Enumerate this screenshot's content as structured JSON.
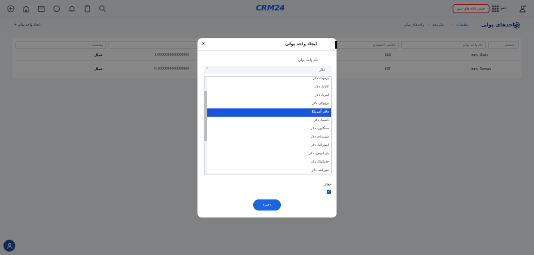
{
  "topbar": {
    "logo": "CRM24",
    "reset_button": "حذف داده های دمو",
    "user_name": "دمو"
  },
  "subheader": {
    "page_title": "واحدهای پولی",
    "breadcrumb": [
      "تنظیمات",
      "پیکربندی",
      "واحدهای پولی"
    ],
    "create_link": "+ ایجاد واحد پولی"
  },
  "table": {
    "filters": [
      "جستجو",
      "نام واحد پولی",
      "علامت اختصاری",
      "نرخ برابری",
      "وضعیت"
    ],
    "rows": [
      {
        "name": "Iran, Rials",
        "symbol": "IRR",
        "rate": "1.0000000000000000",
        "status": "فعال"
      },
      {
        "name": "Iran, Toman",
        "symbol": "IRT",
        "rate": "0.1000000000000000",
        "status": "فعال"
      }
    ]
  },
  "modal": {
    "title": "ایجاد واحد پولی",
    "close": "×",
    "field_label": "نام واحد پولی",
    "select_value": "دلار",
    "options": [
      {
        "label": "برمودا، دلار",
        "selected": false
      },
      {
        "label": "کانادا، دلار",
        "selected": false
      },
      {
        "label": "لیبریا، دلار",
        "selected": false
      },
      {
        "label": "توووالو، دلار",
        "selected": false
      },
      {
        "label": "دلار آمریکا",
        "selected": true
      },
      {
        "label": "نامیبیا، دلار",
        "selected": false
      },
      {
        "label": "سنگاپور، دلار",
        "selected": false
      },
      {
        "label": "سورینام، دلار",
        "selected": false
      },
      {
        "label": "استرالیا، دلار",
        "selected": false
      },
      {
        "label": "باربادوس، دلار",
        "selected": false
      },
      {
        "label": "جامائیکا، دلار",
        "selected": false
      },
      {
        "label": "نیوزیلند، دلار",
        "selected": false
      }
    ],
    "active_label": "فعال",
    "active_checked": true,
    "save_button": "ذخیره"
  }
}
